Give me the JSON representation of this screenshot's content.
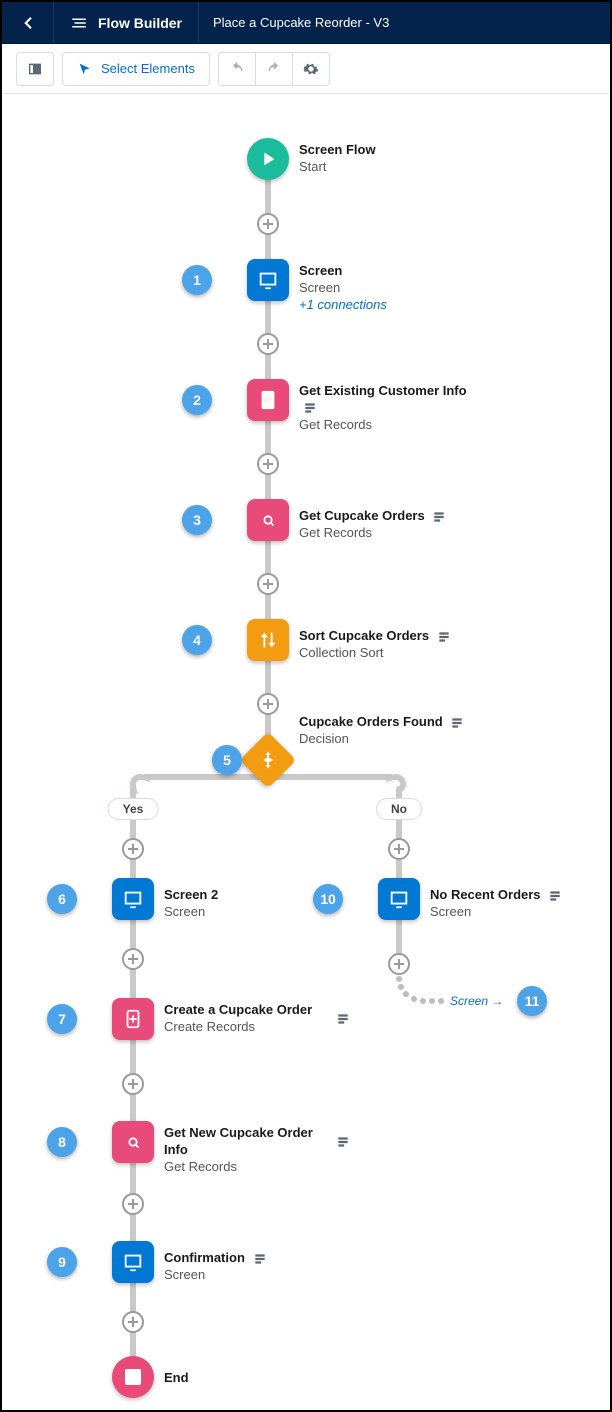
{
  "header": {
    "app": "Flow Builder",
    "title": "Place a Cupcake Reorder - V3"
  },
  "toolbar": {
    "select": "Select Elements"
  },
  "paths": {
    "yes": "Yes",
    "no": "No"
  },
  "goto": {
    "label": "Screen →"
  },
  "nodes": {
    "start": {
      "title": "Screen Flow",
      "sub": "Start"
    },
    "n1": {
      "title": "Screen",
      "sub": "Screen",
      "extra": "+1 connections"
    },
    "n2": {
      "title": "Get Existing Customer Info",
      "sub": "Get Records"
    },
    "n3": {
      "title": "Get Cupcake Orders",
      "sub": "Get Records"
    },
    "n4": {
      "title": "Sort Cupcake Orders",
      "sub": "Collection Sort"
    },
    "n5": {
      "title": "Cupcake Orders Found",
      "sub": "Decision"
    },
    "n6": {
      "title": "Screen 2",
      "sub": "Screen"
    },
    "n7": {
      "title": "Create a Cupcake Order",
      "sub": "Create Records"
    },
    "n8": {
      "title": "Get New Cupcake Order Info",
      "sub": "Get Records"
    },
    "n9": {
      "title": "Confirmation",
      "sub": "Screen"
    },
    "n10": {
      "title": "No Recent Orders",
      "sub": "Screen"
    },
    "end": {
      "title": "End"
    }
  },
  "markers": {
    "1": "1",
    "2": "2",
    "3": "3",
    "4": "4",
    "5": "5",
    "6": "6",
    "7": "7",
    "8": "8",
    "9": "9",
    "10": "10",
    "11": "11"
  }
}
